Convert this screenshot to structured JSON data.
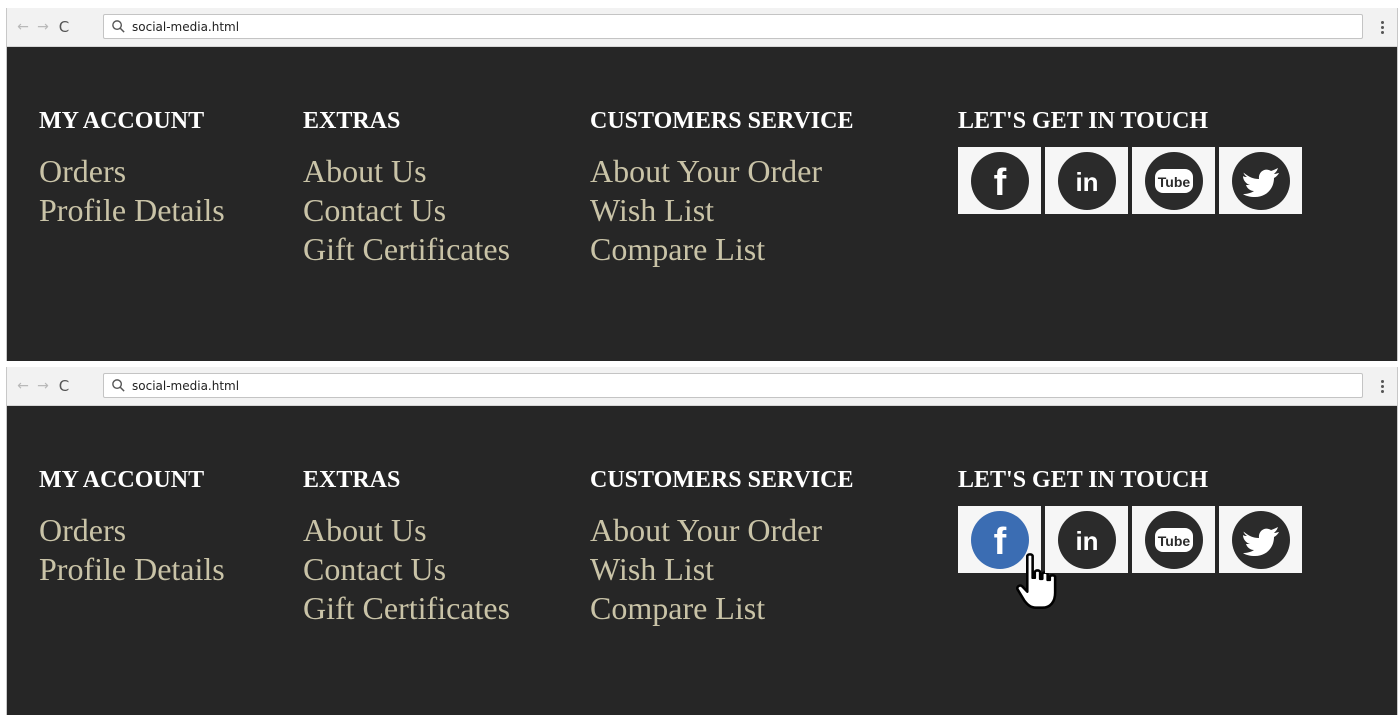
{
  "browser": {
    "url": "social-media.html",
    "icons": {
      "back": "←",
      "forward": "→",
      "reload": "C"
    }
  },
  "footer": {
    "columns": [
      {
        "heading": "MY ACCOUNT",
        "links": [
          "Orders",
          "Profile Details"
        ]
      },
      {
        "heading": "EXTRAS",
        "links": [
          "About Us",
          "Contact Us",
          "Gift Certificates"
        ]
      },
      {
        "heading": "CUSTOMERS SERVICE",
        "links": [
          "About Your Order",
          "Wish List",
          "Compare List"
        ]
      },
      {
        "heading": "LET'S GET IN TOUCH"
      }
    ],
    "social": [
      {
        "name": "facebook-icon",
        "glyph": "f"
      },
      {
        "name": "linkedin-icon",
        "glyph": "in"
      },
      {
        "name": "youtube-icon",
        "glyph": "Tube"
      },
      {
        "name": "twitter-icon"
      }
    ]
  },
  "colors": {
    "footer_bg": "#262626",
    "heading": "#ffffff",
    "link": "#c9c3a7",
    "icon_dark": "#2b2b2b",
    "icon_hover": "#3b6db3"
  },
  "states": {
    "top": "default",
    "bottom": "facebook-hover"
  }
}
